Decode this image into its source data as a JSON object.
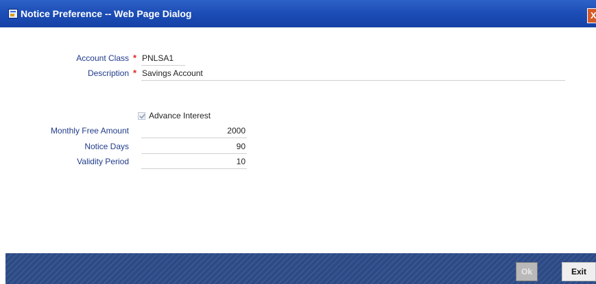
{
  "window": {
    "title": "Notice Preference -- Web Page Dialog",
    "close_glyph": "X"
  },
  "form": {
    "account_class": {
      "label": "Account Class",
      "required_mark": "*",
      "value": "PNLSA1"
    },
    "description": {
      "label": "Description",
      "required_mark": "*",
      "value": "Savings Account"
    },
    "advance_interest": {
      "label": "Advance Interest",
      "checked": true,
      "enabled": false
    },
    "monthly_free_amount": {
      "label": "Monthly Free Amount",
      "value": "2000"
    },
    "notice_days": {
      "label": "Notice Days",
      "value": "90"
    },
    "validity_period": {
      "label": "Validity Period",
      "value": "10"
    }
  },
  "footer": {
    "ok_label": "Ok",
    "exit_label": "Exit"
  },
  "colors": {
    "titlebar": "#1c4eb7",
    "label": "#1f3a8a",
    "required": "#e0281f",
    "footer": "#2c4a86"
  },
  "icons": {
    "title_icon": "dialog-app-icon",
    "close_icon": "close-icon"
  }
}
